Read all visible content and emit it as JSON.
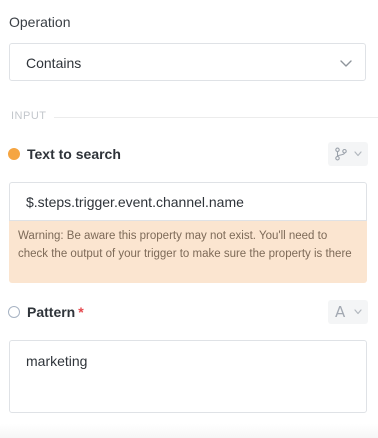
{
  "operation": {
    "label": "Operation",
    "selected": "Contains"
  },
  "section": {
    "title": "INPUT"
  },
  "text_to_search": {
    "label": "Text to search",
    "value": "$.steps.trigger.event.channel.name",
    "warning": "Warning: Be aware this property may not exist. You'll need to check the output of your trigger to make sure the property is there",
    "type_icon": "branch-icon",
    "status_color": "#f5a542"
  },
  "pattern": {
    "label": "Pattern",
    "required_mark": "*",
    "value": "marketing",
    "type_glyph": "A"
  },
  "colors": {
    "warning_bg": "#fbe5d0",
    "required": "#e5484d",
    "border": "#dfe2e6"
  }
}
